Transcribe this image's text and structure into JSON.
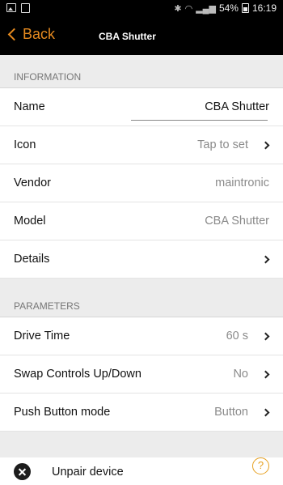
{
  "status_bar": {
    "left_icons": [
      "image-icon",
      "clipboard-icon"
    ],
    "right_icons": [
      "bluetooth-icon",
      "wifi-icon",
      "signal-icon",
      "battery-icon"
    ],
    "battery": "54%",
    "time": "16:19"
  },
  "nav": {
    "back_label": "Back",
    "title": "CBA Shutter",
    "accent_color": "#e68a1f"
  },
  "information": {
    "header": "INFORMATION",
    "rows": [
      {
        "label": "Name",
        "value": "CBA Shutter"
      },
      {
        "label": "Icon",
        "value": "Tap to set"
      },
      {
        "label": "Vendor",
        "value": "maintronic"
      },
      {
        "label": "Model",
        "value": "CBA Shutter"
      },
      {
        "label": "Details",
        "value": ""
      }
    ]
  },
  "parameters": {
    "header": "PARAMETERS",
    "rows": [
      {
        "label": "Drive Time",
        "value": "60 s"
      },
      {
        "label": "Swap Controls Up/Down",
        "value": "No"
      },
      {
        "label": "Push Button mode",
        "value": "Button"
      }
    ]
  },
  "footer": {
    "unpair_label": "Unpair device",
    "help_glyph": "?"
  }
}
